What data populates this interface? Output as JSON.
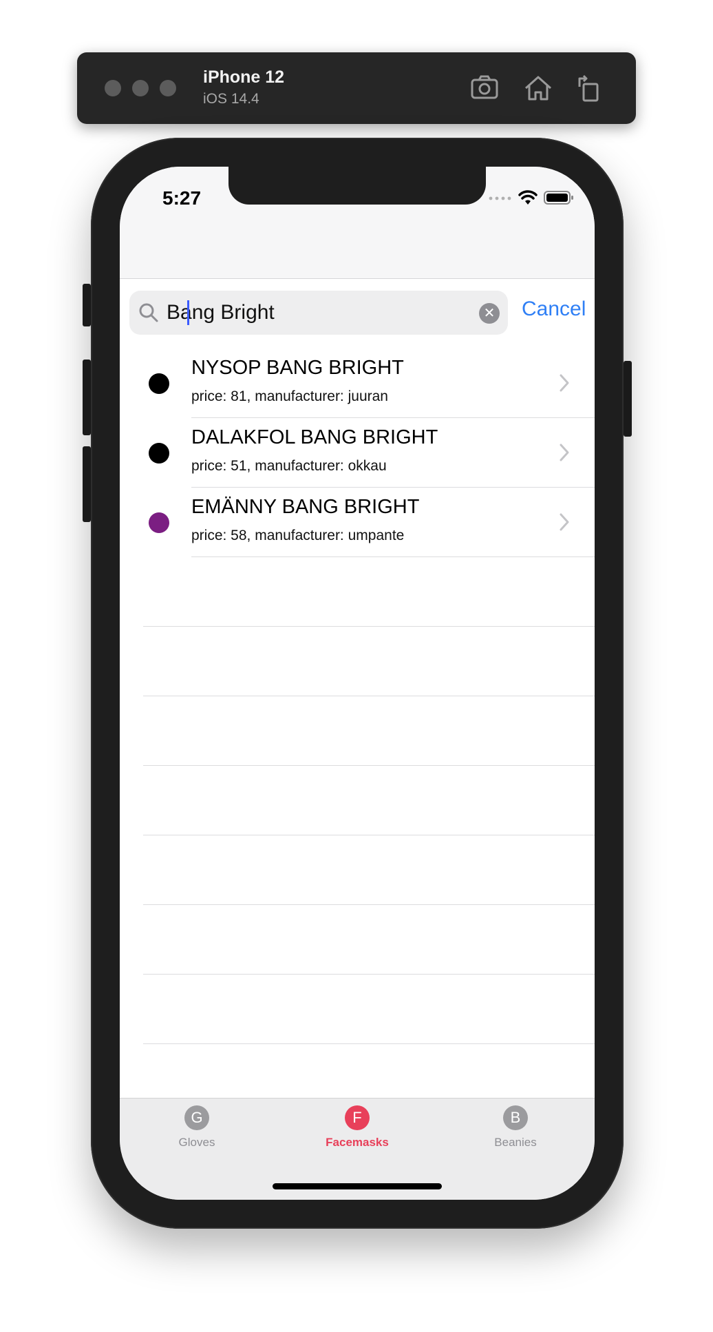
{
  "simulator": {
    "device": "iPhone 12",
    "os": "iOS 14.4"
  },
  "status_bar": {
    "time": "5:27"
  },
  "search": {
    "value": "Bang Bright",
    "cancel_label": "Cancel"
  },
  "results": [
    {
      "title": "NYSOP BANG BRIGHT",
      "subtitle": "price: 81, manufacturer: juuran",
      "color": "#000000"
    },
    {
      "title": "DALAKFOL BANG BRIGHT",
      "subtitle": "price: 51, manufacturer: okkau",
      "color": "#000000"
    },
    {
      "title": "EMÄNNY BANG BRIGHT",
      "subtitle": "price: 58, manufacturer: umpante",
      "color": "#7b1e82"
    }
  ],
  "tabs": [
    {
      "letter": "G",
      "label": "Gloves",
      "active": false
    },
    {
      "letter": "F",
      "label": "Facemasks",
      "active": true
    },
    {
      "letter": "B",
      "label": "Beanies",
      "active": false
    }
  ],
  "colors": {
    "accent": "#2f7ff5",
    "active_tab": "#e8405a",
    "inactive_tab": "#8e8e93"
  }
}
